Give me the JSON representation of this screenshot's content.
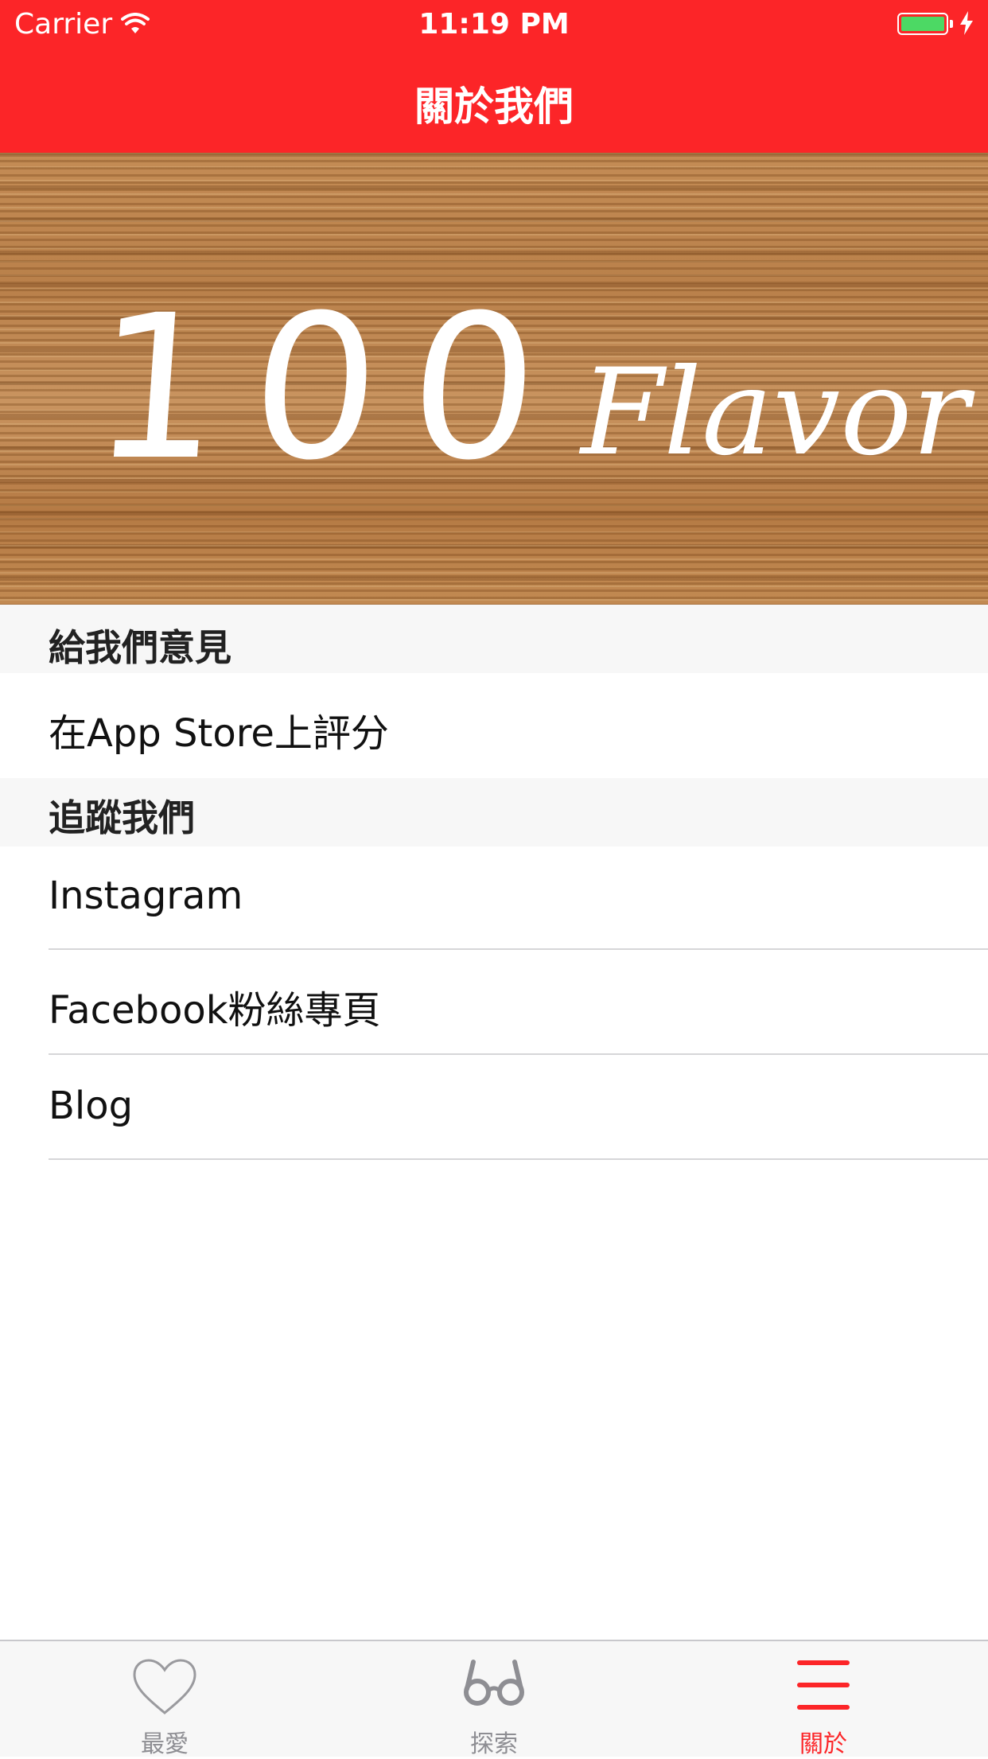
{
  "status_bar": {
    "carrier": "Carrier",
    "time": "11:19 PM"
  },
  "nav": {
    "title": "關於我們"
  },
  "banner": {
    "number": "100",
    "word": "Flavor"
  },
  "sections": [
    {
      "header": "給我們意見",
      "items": [
        "在App Store上評分"
      ]
    },
    {
      "header": "追蹤我們",
      "items": [
        "Instagram",
        "Facebook粉絲專頁",
        "Blog"
      ]
    }
  ],
  "tabbar": {
    "tabs": [
      {
        "label": "最愛",
        "icon": "heart-icon"
      },
      {
        "label": "探索",
        "icon": "glasses-icon"
      },
      {
        "label": "關於",
        "icon": "menu-lines-icon",
        "active": true
      }
    ]
  },
  "colors": {
    "accent": "#fc2528",
    "battery": "#4cd964",
    "tab_inactive": "#8e8e93"
  }
}
